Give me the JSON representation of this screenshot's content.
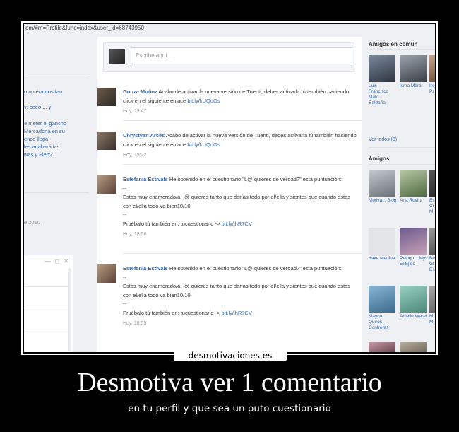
{
  "browser": {
    "url": "om/#m=Profile&func=index&user_id=68743950"
  },
  "left_column": {
    "fragments": [
      "o no éramos tan",
      "y: ceeo ... y",
      "e meter el gancho",
      "Mercadona en su",
      "enca llega",
      "les acabará las",
      "was y Fieb?"
    ],
    "date_fragment": "e 2010",
    "chat_controls": "— ◻ ✕"
  },
  "feed": {
    "compose_placeholder": "Escribe aquí...",
    "posts": [
      {
        "author": "Gonza Muñoz",
        "text": "Acabo de activar la nueva versión de Tuenti, debes activarla tú también haciendo click en el siguiente enlace",
        "link": "bit.ly/kUQuOs",
        "time": "Hoy, 19:47"
      },
      {
        "author": "Chrystyan Arcés",
        "text": "Acabo de activar la nueva versión de Tuenti, debes activarla tú también haciendo click en el siguiente enlace",
        "link": "bit.ly/kUQuOs",
        "time": "Hoy, 19:22"
      },
      {
        "author": "Estefania Estivals",
        "text": "He obtenido en el cuestionario \"L@ quieres de verdad?\" esta puntuación:",
        "dash1": "--",
        "quote": "Estas muy enamorado/a, l@ quieres tanto que darías todo por el/ella y sientes que cuando estas con el/ella todo va bien10/10",
        "dash2": "--",
        "try_text": "Pruébalo tú también en: tucuestionario ->",
        "link": "bit.ly/jhR7CV",
        "time": "Hoy, 18:56"
      },
      {
        "author": "Estefania Estivals",
        "text": "He obtenido en el cuestionario \"L@ quieres de verdad?\" esta puntuación:",
        "dash1": "--",
        "quote": "Estas muy enamorado/a, l@ quieres tanto que darías todo por el/ella y sientes que cuando estas con el/ella todo va bien10/10",
        "dash2": "--",
        "try_text": "Pruébalo tú también en: tucuestionario ->",
        "link": "bit.ly/jhR7CV",
        "time": "Hoy, 18:55"
      }
    ]
  },
  "right_column": {
    "common_friends_title": "Amigos en común",
    "common_friends": [
      {
        "name": "Luis Francisco Mato Saldaña"
      },
      {
        "name": "Isma Martir"
      },
      {
        "name": "Ire Pr"
      }
    ],
    "see_all": "Ver todos (5)",
    "friends_title": "Amigos",
    "friends": [
      {
        "name": "Motiva... Blog"
      },
      {
        "name": "Ana Rovira"
      },
      {
        "name": "Es Cr M"
      },
      {
        "name": "Yake Medina"
      },
      {
        "name": "Peluqu... Mys El Ejido"
      },
      {
        "name": "Be Gl Es"
      },
      {
        "name": "Mayco Quiros Contreras"
      },
      {
        "name": "Amelie Waret"
      },
      {
        "name": "M M"
      }
    ]
  },
  "watermark": "desmotivaciones.es",
  "caption": {
    "title": "Desmotiva ver 1 comentario",
    "subtitle": "en tu perfil y que sea un puto cuestionario"
  },
  "colors": {
    "link_blue": "#3b6aa7",
    "page_bg": "#eef0f3",
    "poster_bg": "#000000"
  }
}
